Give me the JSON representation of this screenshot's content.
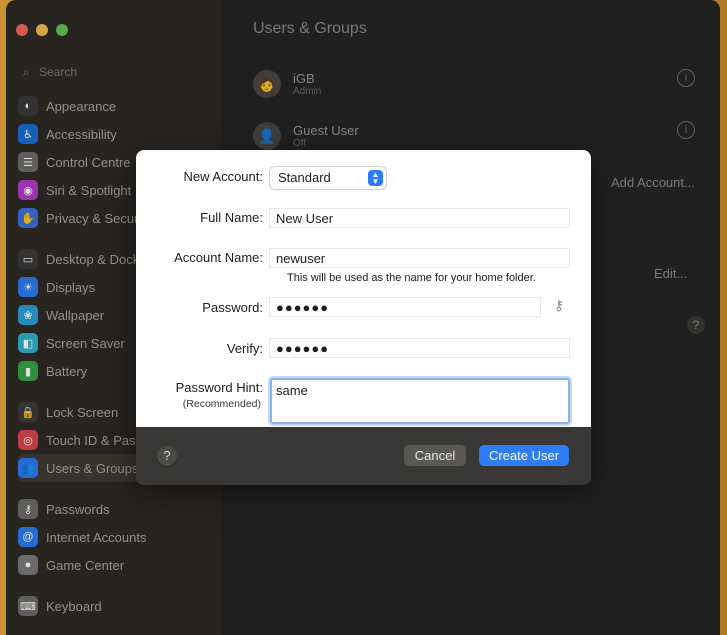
{
  "window": {
    "title": "Users & Groups"
  },
  "sidebar": {
    "search_placeholder": "Search",
    "items": [
      {
        "label": "Appearance",
        "icon": "appearance-icon",
        "color": "#3b3b3b"
      },
      {
        "label": "Accessibility",
        "icon": "accessibility-icon",
        "color": "#1b6fd8"
      },
      {
        "label": "Control Centre",
        "icon": "control-centre-icon",
        "color": "#6b6b6b"
      },
      {
        "label": "Siri & Spotlight",
        "icon": "siri-icon",
        "color": "#b13cc9"
      },
      {
        "label": "Privacy & Security",
        "icon": "privacy-hand-icon",
        "color": "#3d6fd6"
      },
      {
        "label": "Desktop & Dock",
        "icon": "desktop-dock-icon",
        "color": "#3b3b3b"
      },
      {
        "label": "Displays",
        "icon": "displays-icon",
        "color": "#2d7cf0"
      },
      {
        "label": "Wallpaper",
        "icon": "wallpaper-icon",
        "color": "#2aa0d8"
      },
      {
        "label": "Screen Saver",
        "icon": "screen-saver-icon",
        "color": "#2fb0c8"
      },
      {
        "label": "Battery",
        "icon": "battery-icon",
        "color": "#3aa34a"
      },
      {
        "label": "Lock Screen",
        "icon": "lock-screen-icon",
        "color": "#3b3b3b"
      },
      {
        "label": "Touch ID & Password",
        "icon": "fingerprint-icon",
        "color": "#d8464a"
      },
      {
        "label": "Users & Groups",
        "icon": "users-groups-icon",
        "color": "#2d7cf0"
      },
      {
        "label": "Passwords",
        "icon": "passwords-key-icon",
        "color": "#6b6b6b"
      },
      {
        "label": "Internet Accounts",
        "icon": "internet-accounts-icon",
        "color": "#2d7cf0"
      },
      {
        "label": "Game Center",
        "icon": "game-center-icon",
        "color": "#7a7a7a"
      },
      {
        "label": "Keyboard",
        "icon": "keyboard-icon",
        "color": "#6b6b6b"
      }
    ]
  },
  "content": {
    "users": [
      {
        "name": "iGB",
        "role": "Admin"
      },
      {
        "name": "Guest User",
        "role": "Off"
      }
    ],
    "add_account_label": "Add Account...",
    "edit_label": "Edit..."
  },
  "dialog": {
    "new_account_label": "New Account:",
    "account_type_value": "Standard",
    "full_name_label": "Full Name:",
    "full_name_value": "New User",
    "account_name_label": "Account Name:",
    "account_name_value": "newuser",
    "account_name_note": "This will be used as the name for your home folder.",
    "password_label": "Password:",
    "password_value": "●●●●●●",
    "verify_label": "Verify:",
    "verify_value": "●●●●●●",
    "hint_label": "Password Hint:",
    "hint_sublabel": "(Recommended)",
    "hint_value": "same",
    "help_label": "?",
    "cancel_label": "Cancel",
    "create_label": "Create User"
  },
  "colors": {
    "accent": "#2f7df6",
    "focus_ring": "#8db3ec"
  }
}
